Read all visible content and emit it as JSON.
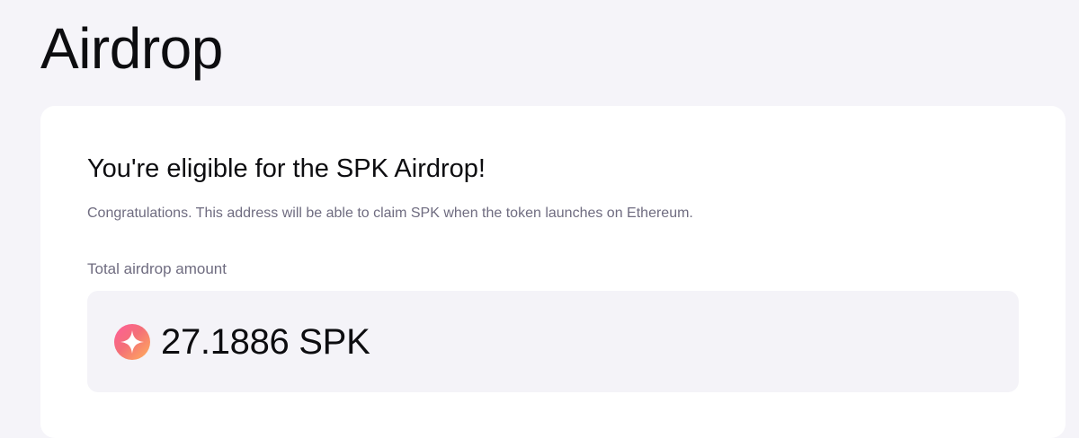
{
  "page": {
    "title": "Airdrop"
  },
  "eligibility_card": {
    "heading": "You're eligible for the SPK Airdrop!",
    "description": "Congratulations. This address will be able to claim SPK when the token launches on Ethereum.",
    "amount_label": "Total airdrop amount",
    "amount": {
      "value": "27.1886",
      "token": "SPK",
      "display": "27.1886 SPK",
      "icon": "spk-token-icon"
    }
  },
  "colors": {
    "background": "#f5f4f9",
    "card": "#ffffff",
    "amount_box": "#f4f3f8",
    "muted_text": "#6f6c80",
    "token_gradient": [
      "#ff5d9a",
      "#f46f78",
      "#ffb05a"
    ]
  }
}
